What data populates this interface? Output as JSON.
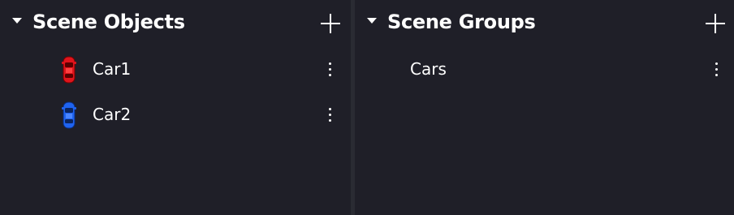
{
  "scene_objects": {
    "title": "Scene Objects",
    "items": [
      {
        "label": "Car1",
        "icon": "red-car-icon",
        "color": "#e0141c"
      },
      {
        "label": "Car2",
        "icon": "blue-car-icon",
        "color": "#1f63f0"
      }
    ]
  },
  "scene_groups": {
    "title": "Scene Groups",
    "items": [
      {
        "label": "Cars"
      }
    ]
  },
  "colors": {
    "background": "#1f1f28",
    "divider": "#2a2b33",
    "text": "#ffffff"
  }
}
